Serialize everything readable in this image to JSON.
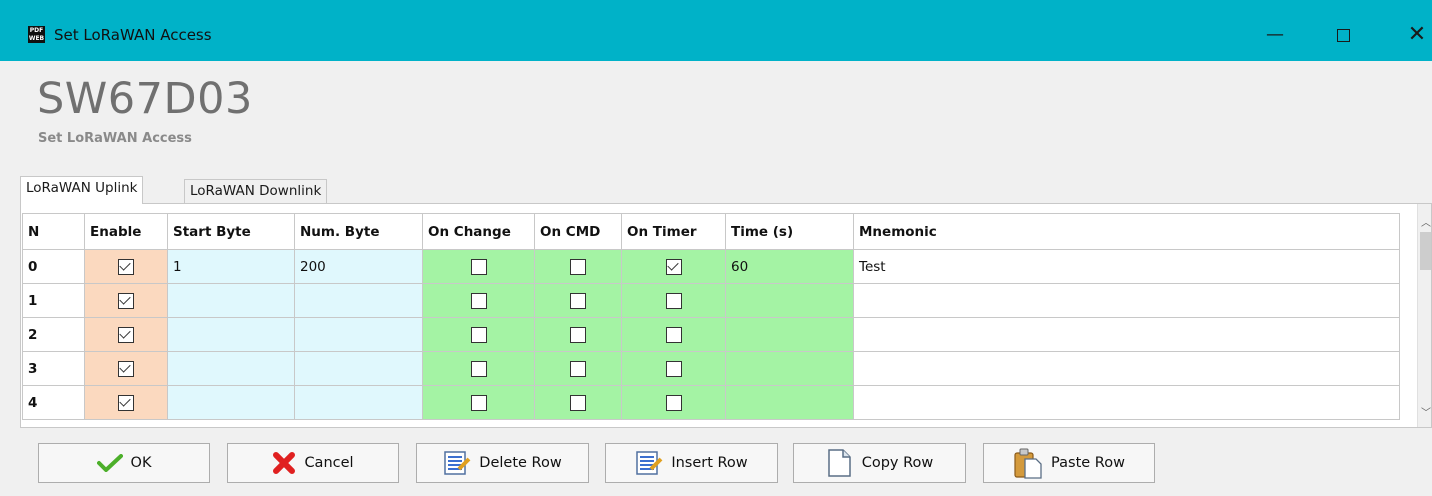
{
  "window": {
    "icon_text": "PDF WEB",
    "title": "Set LoRaWAN Access",
    "controls": {
      "minimize": "—",
      "close": "✕"
    }
  },
  "header": {
    "model": "SW67D03",
    "subtitle": "Set LoRaWAN Access"
  },
  "tabs": [
    {
      "label": "LoRaWAN Uplink",
      "active": true
    },
    {
      "label": "LoRaWAN Downlink",
      "active": false
    }
  ],
  "table": {
    "columns": [
      "N",
      "Enable",
      "Start Byte",
      "Num. Byte",
      "On Change",
      "On CMD",
      "On Timer",
      "Time (s)",
      "Mnemonic"
    ],
    "rows": [
      {
        "n": "0",
        "enable": true,
        "start_byte": "1",
        "num_byte": "200",
        "on_change": false,
        "on_cmd": false,
        "on_timer": true,
        "time": "60",
        "mnemonic": "Test"
      },
      {
        "n": "1",
        "enable": true,
        "start_byte": "",
        "num_byte": "",
        "on_change": false,
        "on_cmd": false,
        "on_timer": false,
        "time": "",
        "mnemonic": ""
      },
      {
        "n": "2",
        "enable": true,
        "start_byte": "",
        "num_byte": "",
        "on_change": false,
        "on_cmd": false,
        "on_timer": false,
        "time": "",
        "mnemonic": ""
      },
      {
        "n": "3",
        "enable": true,
        "start_byte": "",
        "num_byte": "",
        "on_change": false,
        "on_cmd": false,
        "on_timer": false,
        "time": "",
        "mnemonic": ""
      },
      {
        "n": "4",
        "enable": true,
        "start_byte": "",
        "num_byte": "",
        "on_change": false,
        "on_cmd": false,
        "on_timer": false,
        "time": "",
        "mnemonic": ""
      }
    ]
  },
  "buttons": {
    "ok": "OK",
    "cancel": "Cancel",
    "delete_row": "Delete Row",
    "insert_row": "Insert Row",
    "copy_row": "Copy Row",
    "paste_row": "Paste Row"
  },
  "colors": {
    "titlebar": "#00b2c8",
    "enable_column": "#fbd9bf",
    "byte_columns": "#e0f8fd",
    "trigger_columns": "#a4f3a4"
  }
}
